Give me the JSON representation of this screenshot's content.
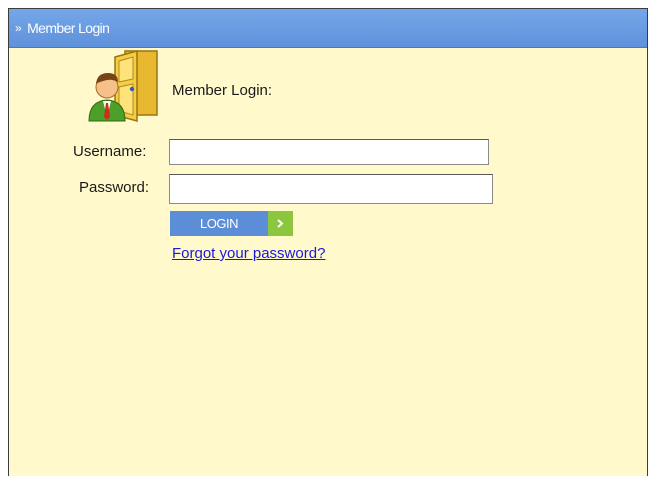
{
  "panel": {
    "title": "Member Login",
    "header_icon": "double-chevron-right-icon",
    "background_color": "#fff9cc",
    "header_color": "#6b9de2"
  },
  "login": {
    "icon": "member-door-icon",
    "intro_label": "Member Login:",
    "username_label": "Username:",
    "username_value": "",
    "password_label": "Password:",
    "password_value": "",
    "submit_label": "LOGIN",
    "submit_icon": "chevron-right-icon",
    "submit_color": "#5b8ed6",
    "submit_arrow_color": "#8cc63f",
    "forgot_password_link": "Forgot your password?",
    "link_color": "#1b19d8"
  }
}
